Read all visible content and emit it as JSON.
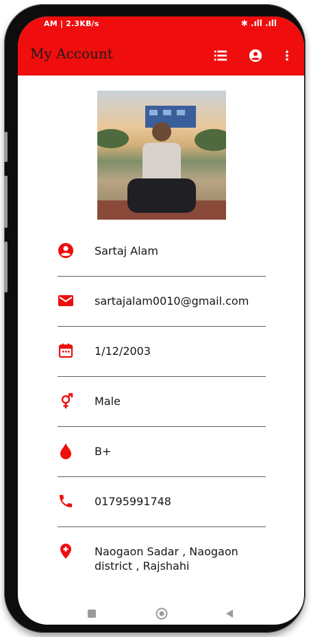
{
  "status": {
    "left": "AM | 2.3KB/s",
    "right": "✱ .ıll .ıll"
  },
  "appbar": {
    "title": "My Account",
    "icons": [
      "list-icon",
      "account-circle-icon",
      "more-vert-icon"
    ],
    "color": "#ef0d0d"
  },
  "profile": {
    "name": "Sartaj Alam",
    "email": "sartajalam0010@gmail.com",
    "dob": "1/12/2003",
    "gender": "Male",
    "blood_group": "B+",
    "phone": "01795991748",
    "address": "Naogaon Sadar , Naogaon district , Rajshahi"
  },
  "icons": {
    "name": "person-icon",
    "email": "mail-icon",
    "dob": "calendar-icon",
    "gender": "gender-icon",
    "blood_group": "blood-drop-icon",
    "phone": "phone-icon",
    "address": "location-pin-icon"
  },
  "navbar": {
    "icons": [
      "recents-icon",
      "home-icon",
      "back-icon"
    ]
  }
}
